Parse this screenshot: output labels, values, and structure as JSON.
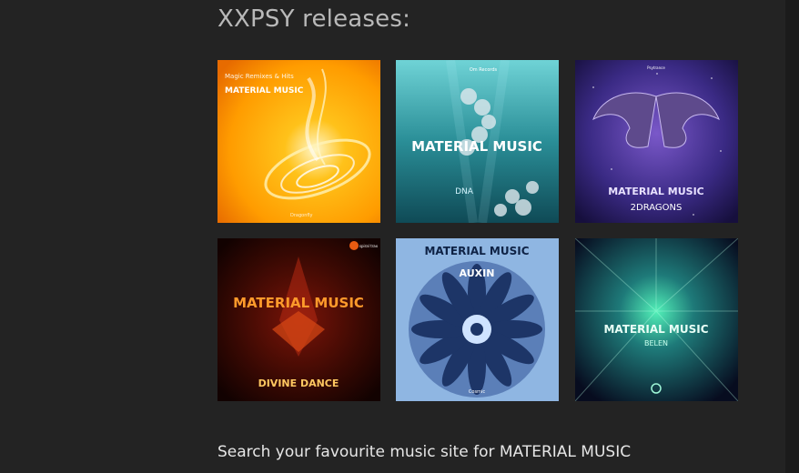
{
  "heading": "XXPSY releases:",
  "releases": [
    {
      "title": "MATERIAL MUSIC",
      "subtitle": "Magic Remixes & Hits",
      "label": "Dragonfly"
    },
    {
      "title": "MATERIAL MUSIC",
      "subtitle": "DNA",
      "label": "Om Records"
    },
    {
      "title": "MATERIAL MUSIC",
      "subtitle": "2DRAGONS",
      "label": "Psytrance"
    },
    {
      "title": "MATERIAL MUSIC",
      "subtitle": "DIVINE DANCE",
      "label": "spiral trax"
    },
    {
      "title": "MATERIAL MUSIC",
      "subtitle": "AUXIN",
      "label": "Cosmic"
    },
    {
      "title": "MATERIAL MUSIC",
      "subtitle": "BELEN",
      "label": ""
    }
  ],
  "footer_text": "Search your favourite music site for MATERIAL MUSIC",
  "colors": {
    "background": "#232323",
    "heading": "#b9b9b9",
    "footer": "#e6e6e6"
  }
}
